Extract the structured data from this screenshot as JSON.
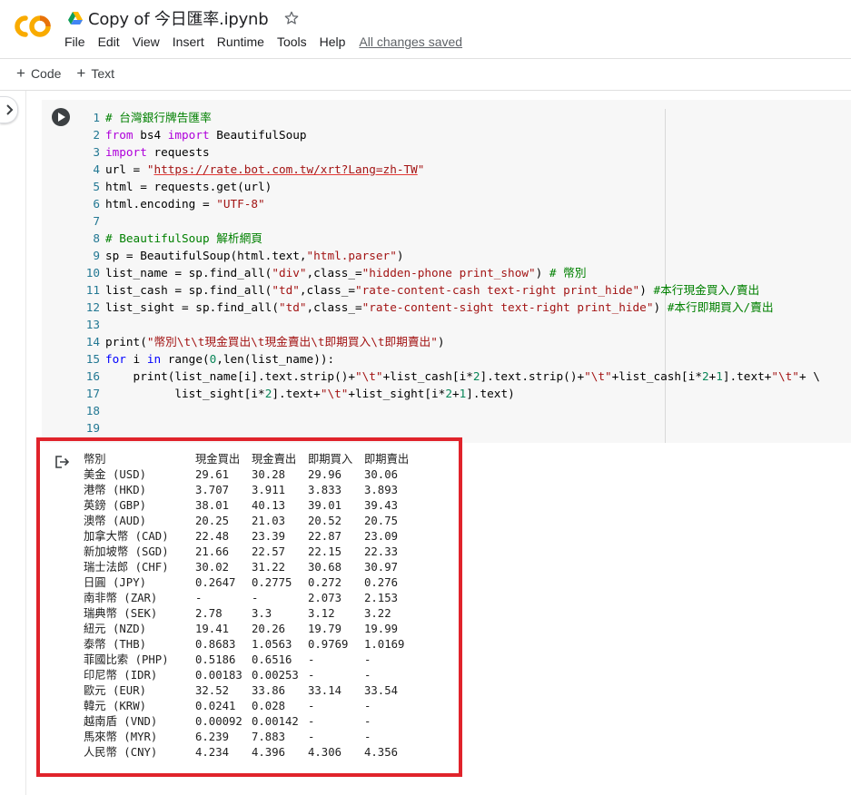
{
  "header": {
    "doc_title": "Copy of 今日匯率.ipynb",
    "menu": [
      "File",
      "Edit",
      "View",
      "Insert",
      "Runtime",
      "Tools",
      "Help"
    ],
    "save_status": "All changes saved"
  },
  "toolbar": {
    "add_code": "Code",
    "add_text": "Text"
  },
  "colors": {
    "logo_orange": "#f9ab00",
    "logo_orange_dark": "#e8710a",
    "highlight": "#e0232b"
  },
  "icons": [
    "colab-logo-icon",
    "drive-icon",
    "star-icon",
    "chevron-right-icon",
    "play-icon",
    "output-icon"
  ],
  "code_lines": [
    [
      [
        "cm",
        "# 台灣銀行牌告匯率"
      ]
    ],
    [
      [
        "kw",
        "from"
      ],
      [
        "t",
        " bs4 "
      ],
      [
        "kw",
        "import"
      ],
      [
        "t",
        " BeautifulSoup"
      ]
    ],
    [
      [
        "kw",
        "import"
      ],
      [
        "t",
        " requests"
      ]
    ],
    [
      [
        "t",
        "url = "
      ],
      [
        "st",
        "\""
      ],
      [
        "url",
        "https://rate.bot.com.tw/xrt?Lang=zh-TW"
      ],
      [
        "st",
        "\""
      ]
    ],
    [
      [
        "t",
        "html = requests.get(url)"
      ]
    ],
    [
      [
        "t",
        "html.encoding = "
      ],
      [
        "st",
        "\"UTF-8\""
      ]
    ],
    [],
    [
      [
        "cm",
        "# BeautifulSoup 解析網頁"
      ]
    ],
    [
      [
        "t",
        "sp = BeautifulSoup(html.text,"
      ],
      [
        "st",
        "\"html.parser\""
      ],
      [
        "t",
        ")"
      ]
    ],
    [
      [
        "t",
        "list_name = sp.find_all("
      ],
      [
        "st",
        "\"div\""
      ],
      [
        "t",
        ",class_="
      ],
      [
        "st",
        "\"hidden-phone print_show\""
      ],
      [
        "t",
        ") "
      ],
      [
        "cm",
        "# 幣別"
      ]
    ],
    [
      [
        "t",
        "list_cash = sp.find_all("
      ],
      [
        "st",
        "\"td\""
      ],
      [
        "t",
        ",class_="
      ],
      [
        "st",
        "\"rate-content-cash text-right print_hide\""
      ],
      [
        "t",
        ") "
      ],
      [
        "cm",
        "#本行現金買入/賣出"
      ]
    ],
    [
      [
        "t",
        "list_sight = sp.find_all("
      ],
      [
        "st",
        "\"td\""
      ],
      [
        "t",
        ",class_="
      ],
      [
        "st",
        "\"rate-content-sight text-right print_hide\""
      ],
      [
        "t",
        ") "
      ],
      [
        "cm",
        "#本行即期買入/賣出"
      ]
    ],
    [],
    [
      [
        "t",
        "print("
      ],
      [
        "st",
        "\"幣別\\t\\t現金買出\\t現金賣出\\t即期買入\\t即期賣出\""
      ],
      [
        "t",
        ")"
      ]
    ],
    [
      [
        "kwb",
        "for"
      ],
      [
        "t",
        " i "
      ],
      [
        "kwb",
        "in"
      ],
      [
        "t",
        " range("
      ],
      [
        "nm",
        "0"
      ],
      [
        "t",
        ",len(list_name)):"
      ]
    ],
    [
      [
        "t",
        "    print(list_name[i].text.strip()+"
      ],
      [
        "st",
        "\"\\t\""
      ],
      [
        "t",
        "+list_cash[i*"
      ],
      [
        "nm",
        "2"
      ],
      [
        "t",
        "].text.strip()+"
      ],
      [
        "st",
        "\"\\t\""
      ],
      [
        "t",
        "+list_cash[i*"
      ],
      [
        "nm",
        "2"
      ],
      [
        "t",
        "+"
      ],
      [
        "nm",
        "1"
      ],
      [
        "t",
        "].text+"
      ],
      [
        "st",
        "\"\\t\""
      ],
      [
        "t",
        "+ \\"
      ]
    ],
    [
      [
        "t",
        "          list_sight[i*"
      ],
      [
        "nm",
        "2"
      ],
      [
        "t",
        "].text+"
      ],
      [
        "st",
        "\"\\t\""
      ],
      [
        "t",
        "+list_sight[i*"
      ],
      [
        "nm",
        "2"
      ],
      [
        "t",
        "+"
      ],
      [
        "nm",
        "1"
      ],
      [
        "t",
        "].text)"
      ]
    ],
    [],
    []
  ],
  "output": {
    "header": [
      "幣別",
      "現金買出",
      "現金賣出",
      "即期買入",
      "即期賣出"
    ],
    "rows": [
      [
        "美金 (USD)",
        "29.61",
        "30.28",
        "29.96",
        "30.06"
      ],
      [
        "港幣 (HKD)",
        "3.707",
        "3.911",
        "3.833",
        "3.893"
      ],
      [
        "英鎊 (GBP)",
        "38.01",
        "40.13",
        "39.01",
        "39.43"
      ],
      [
        "澳幣 (AUD)",
        "20.25",
        "21.03",
        "20.52",
        "20.75"
      ],
      [
        "加拿大幣 (CAD)",
        "22.48",
        "23.39",
        "22.87",
        "23.09"
      ],
      [
        "新加坡幣 (SGD)",
        "21.66",
        "22.57",
        "22.15",
        "22.33"
      ],
      [
        "瑞士法郎 (CHF)",
        "30.02",
        "31.22",
        "30.68",
        "30.97"
      ],
      [
        "日圓 (JPY)",
        "0.2647",
        "0.2775",
        "0.272",
        "0.276"
      ],
      [
        "南非幣 (ZAR)",
        "-",
        "-",
        "2.073",
        "2.153"
      ],
      [
        "瑞典幣 (SEK)",
        "2.78",
        "3.3",
        "3.12",
        "3.22"
      ],
      [
        "紐元 (NZD)",
        "19.41",
        "20.26",
        "19.79",
        "19.99"
      ],
      [
        "泰幣 (THB)",
        "0.8683",
        "1.0563",
        "0.9769",
        "1.0169"
      ],
      [
        "菲國比索 (PHP)",
        "0.5186",
        "0.6516",
        "-",
        "-"
      ],
      [
        "印尼幣 (IDR)",
        "0.00183",
        "0.00253",
        "-",
        "-"
      ],
      [
        "歐元 (EUR)",
        "32.52",
        "33.86",
        "33.14",
        "33.54"
      ],
      [
        "韓元 (KRW)",
        "0.0241",
        "0.028",
        "-",
        "-"
      ],
      [
        "越南盾 (VND)",
        "0.00092",
        "0.00142",
        "-",
        "-"
      ],
      [
        "馬來幣 (MYR)",
        "6.239",
        "7.883",
        "-",
        "-"
      ],
      [
        "人民幣 (CNY)",
        "4.234",
        "4.396",
        "4.306",
        "4.356"
      ]
    ]
  }
}
